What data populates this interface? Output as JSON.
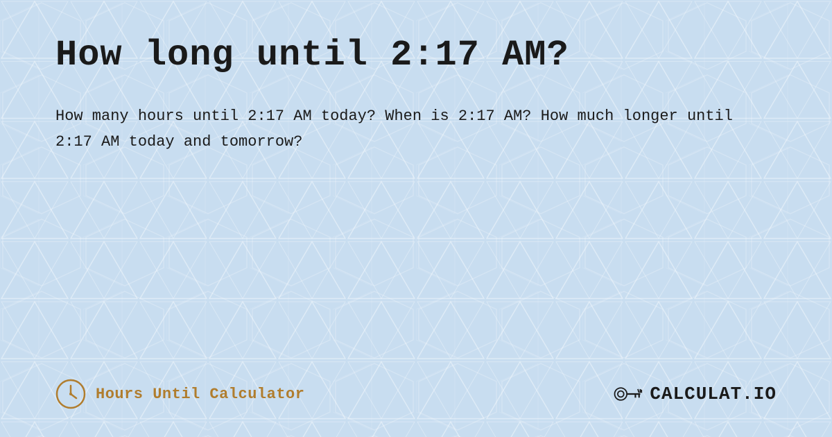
{
  "page": {
    "title": "How long until 2:17 AM?",
    "description": "How many hours until 2:17 AM today? When is 2:17 AM? How much longer until 2:17 AM today and tomorrow?",
    "background_color": "#c8ddf0",
    "text_color": "#1a1a1a"
  },
  "footer": {
    "brand_left_label": "Hours Until Calculator",
    "brand_right_label": "CALCULAT.IO",
    "clock_icon": "clock",
    "calc_icon": "calculator"
  }
}
